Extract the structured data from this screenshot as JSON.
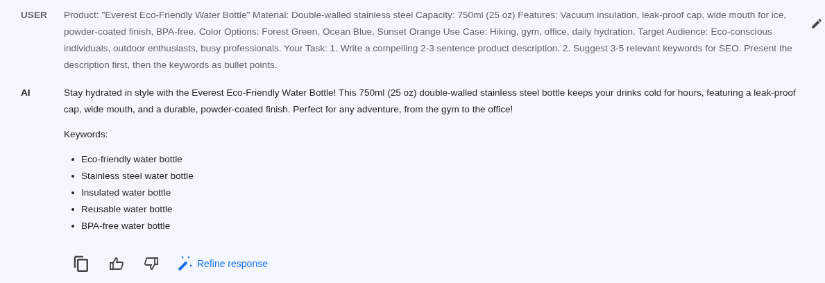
{
  "turns": [
    {
      "role": "USER",
      "text": "Product: \"Everest Eco-Friendly Water Bottle\" Material: Double-walled stainless steel Capacity: 750ml (25 oz) Features: Vacuum insulation, leak-proof cap, wide mouth for ice, powder-coated finish, BPA-free. Color Options: Forest Green, Ocean Blue, Sunset Orange Use Case: Hiking, gym, office, daily hydration. Target Audience: Eco-conscious individuals, outdoor enthusiasts, busy professionals. Your Task: 1. Write a compelling 2-3 sentence product description. 2. Suggest 3-5 relevant keywords for SEO. Present the description first, then the keywords as bullet points."
    },
    {
      "role": "AI",
      "text": "Stay hydrated in style with the Everest Eco-Friendly Water Bottle! This 750ml (25 oz) double-walled stainless steel bottle keeps your drinks cold for hours, featuring a leak-proof cap, wide mouth, and a durable, powder-coated finish. Perfect for any adventure, from the gym to the office!",
      "heading": "Keywords:",
      "bullets": [
        "Eco-friendly water bottle",
        "Stainless steel water bottle",
        "Insulated water bottle",
        "Reusable water bottle",
        "BPA-free water bottle"
      ]
    }
  ],
  "actions": {
    "refine": "Refine response"
  }
}
